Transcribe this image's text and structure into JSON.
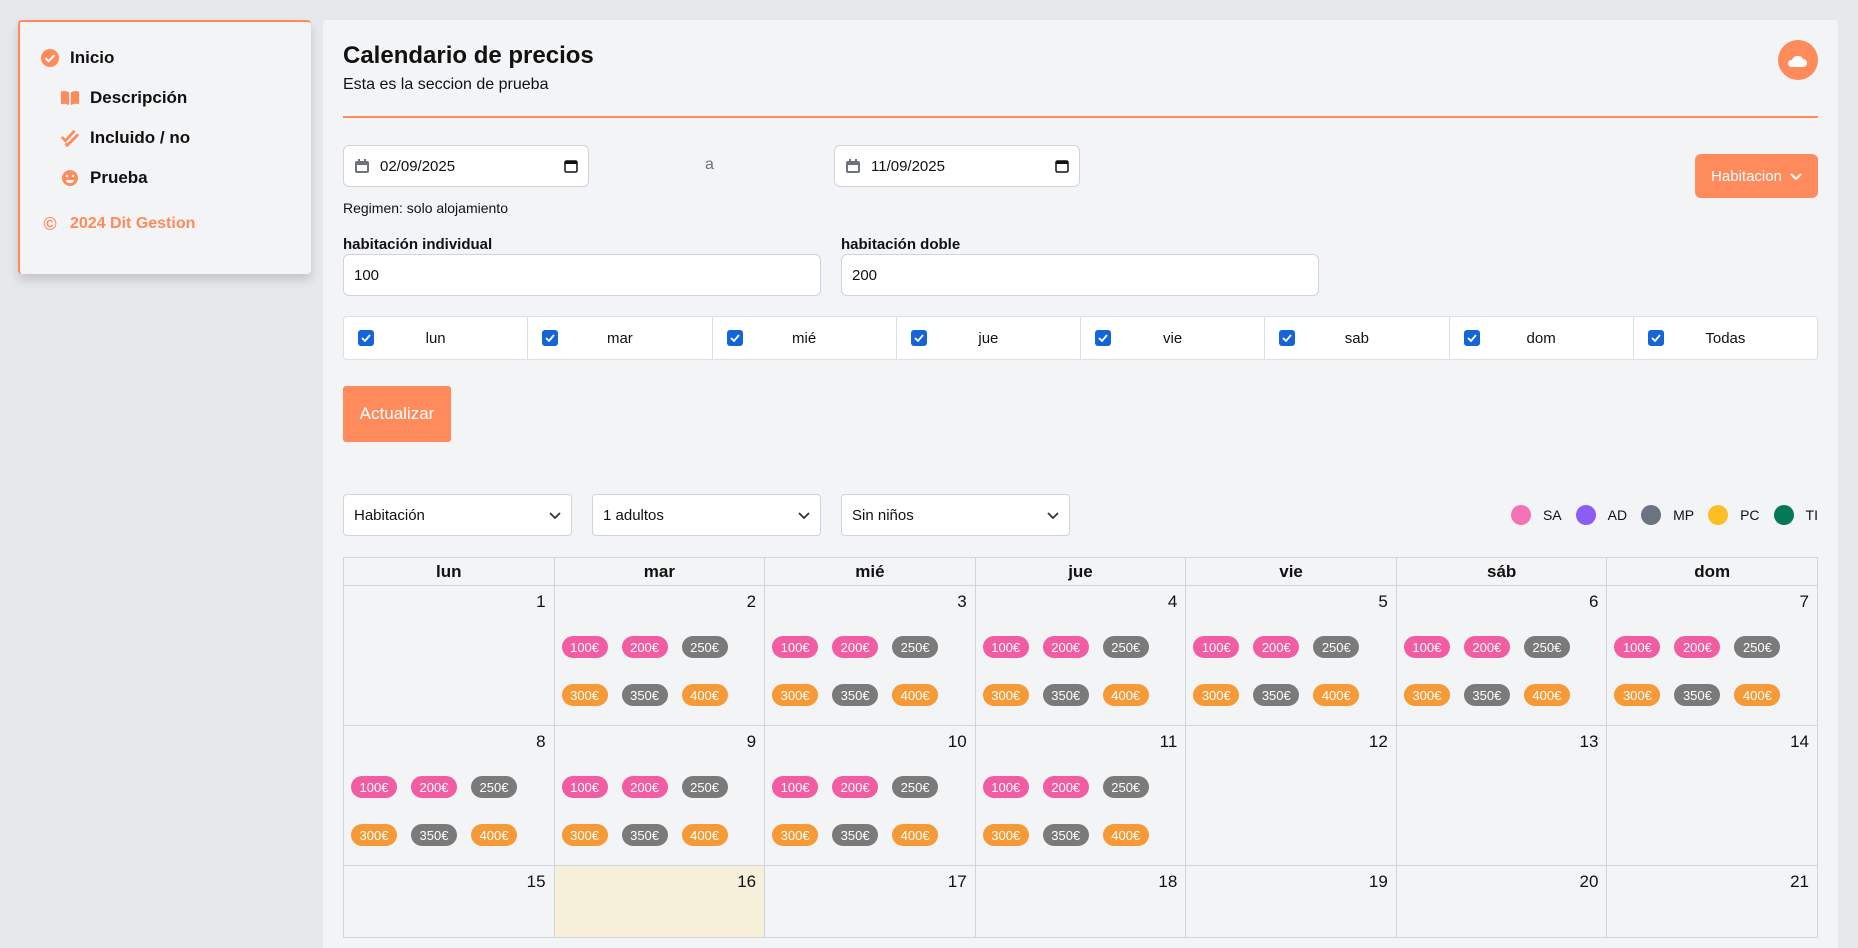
{
  "sidebar": {
    "items": [
      {
        "label": "Inicio",
        "icon": "check-circle-icon"
      },
      {
        "label": "Descripción",
        "icon": "book-icon"
      },
      {
        "label": "Incluido / no",
        "icon": "double-check-icon"
      },
      {
        "label": "Prueba",
        "icon": "smile-icon"
      }
    ],
    "copyright": "2024 Dit Gestion"
  },
  "header": {
    "title": "Calendario de precios",
    "subtitle": "Esta es la seccion de prueba"
  },
  "dates": {
    "from": "02/09/2025",
    "separator": "a",
    "to": "11/09/2025"
  },
  "habitacion_button": "Habitacion",
  "regimen": "Regimen: solo alojamiento",
  "fields": {
    "individual": {
      "label": "habitación individual",
      "value": "100"
    },
    "doble": {
      "label": "habitación doble",
      "value": "200"
    }
  },
  "days": [
    "lun",
    "mar",
    "mié",
    "jue",
    "vie",
    "sab",
    "dom",
    "Todas"
  ],
  "update_button": "Actualizar",
  "filters": {
    "room": "Habitación",
    "adults": "1 adultos",
    "children": "Sin niños"
  },
  "legend": [
    {
      "label": "SA",
      "color": "#f472b6"
    },
    {
      "label": "AD",
      "color": "#8b5cf6"
    },
    {
      "label": "MP",
      "color": "#6b7280"
    },
    {
      "label": "PC",
      "color": "#fbbf24"
    },
    {
      "label": "TI",
      "color": "#047857"
    }
  ],
  "calendar": {
    "headers": [
      "lun",
      "mar",
      "mié",
      "jue",
      "vie",
      "sáb",
      "dom"
    ],
    "price_labels": [
      "100€",
      "200€",
      "250€",
      "300€",
      "350€",
      "400€"
    ],
    "price_colors": [
      "#f25ca2",
      "#f25ca2",
      "#7a7a7a",
      "#f59a36",
      "#7a7a7a",
      "#f59a36"
    ],
    "weeks": [
      [
        {
          "day": "1",
          "prices": false
        },
        {
          "day": "2",
          "prices": true
        },
        {
          "day": "3",
          "prices": true
        },
        {
          "day": "4",
          "prices": true
        },
        {
          "day": "5",
          "prices": true
        },
        {
          "day": "6",
          "prices": true
        },
        {
          "day": "7",
          "prices": true
        }
      ],
      [
        {
          "day": "8",
          "prices": true
        },
        {
          "day": "9",
          "prices": true
        },
        {
          "day": "10",
          "prices": true
        },
        {
          "day": "11",
          "prices": true
        },
        {
          "day": "12",
          "prices": false
        },
        {
          "day": "13",
          "prices": false
        },
        {
          "day": "14",
          "prices": false
        }
      ],
      [
        {
          "day": "15",
          "prices": false
        },
        {
          "day": "16",
          "prices": false,
          "today": true
        },
        {
          "day": "17",
          "prices": false
        },
        {
          "day": "18",
          "prices": false
        },
        {
          "day": "19",
          "prices": false
        },
        {
          "day": "20",
          "prices": false
        },
        {
          "day": "21",
          "prices": false
        }
      ]
    ]
  }
}
